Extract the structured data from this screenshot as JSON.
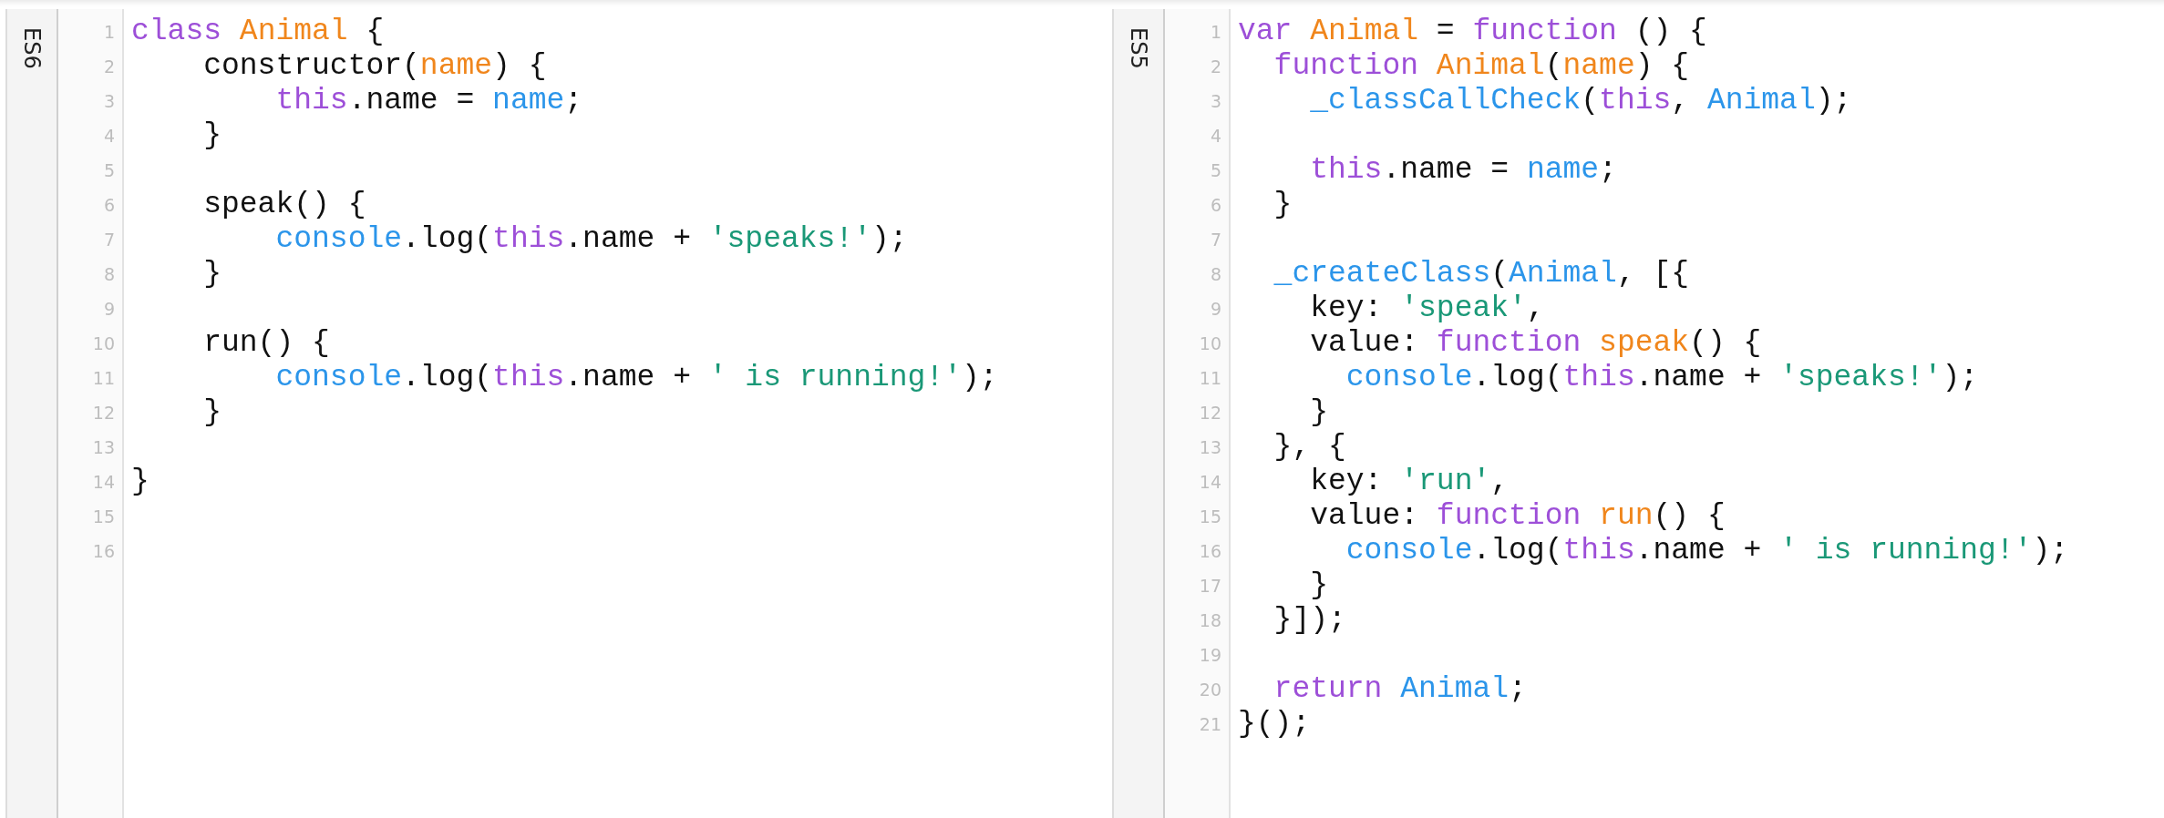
{
  "panels": [
    {
      "label": "ES6",
      "lines": [
        {
          "number": "1",
          "tokens": [
            {
              "kind": "keyword",
              "text": "class"
            },
            {
              "kind": "def",
              "text": " Animal"
            },
            {
              "kind": "plain",
              "text": " {"
            }
          ]
        },
        {
          "number": "2",
          "tokens": [
            {
              "kind": "plain",
              "text": "    constructor("
            },
            {
              "kind": "def",
              "text": "name"
            },
            {
              "kind": "plain",
              "text": ") {"
            }
          ]
        },
        {
          "number": "3",
          "tokens": [
            {
              "kind": "keyword",
              "text": "        this"
            },
            {
              "kind": "plain",
              "text": ".name = "
            },
            {
              "kind": "variable",
              "text": "name"
            },
            {
              "kind": "plain",
              "text": ";"
            }
          ]
        },
        {
          "number": "4",
          "tokens": [
            {
              "kind": "plain",
              "text": "    }"
            }
          ]
        },
        {
          "number": "5"
        },
        {
          "number": "6",
          "tokens": [
            {
              "kind": "plain",
              "text": "    speak() {"
            }
          ]
        },
        {
          "number": "7",
          "tokens": [
            {
              "kind": "variable",
              "text": "        console"
            },
            {
              "kind": "plain",
              "text": ".log("
            },
            {
              "kind": "keyword",
              "text": "this"
            },
            {
              "kind": "plain",
              "text": ".name + "
            },
            {
              "kind": "string",
              "text": "'speaks!'"
            },
            {
              "kind": "plain",
              "text": ");"
            }
          ]
        },
        {
          "number": "8",
          "tokens": [
            {
              "kind": "plain",
              "text": "    }"
            }
          ]
        },
        {
          "number": "9"
        },
        {
          "number": "10",
          "tokens": [
            {
              "kind": "plain",
              "text": "    run() {"
            }
          ]
        },
        {
          "number": "11",
          "tokens": [
            {
              "kind": "variable",
              "text": "        console"
            },
            {
              "kind": "plain",
              "text": ".log("
            },
            {
              "kind": "keyword",
              "text": "this"
            },
            {
              "kind": "plain",
              "text": ".name + "
            },
            {
              "kind": "string",
              "text": "' is running!'"
            },
            {
              "kind": "plain",
              "text": ");"
            }
          ]
        },
        {
          "number": "12",
          "tokens": [
            {
              "kind": "plain",
              "text": "    }"
            }
          ]
        },
        {
          "number": "13"
        },
        {
          "number": "14",
          "tokens": [
            {
              "kind": "plain",
              "text": "}"
            }
          ]
        },
        {
          "number": "15"
        },
        {
          "number": "16"
        }
      ]
    },
    {
      "label": "ES5",
      "lines": [
        {
          "number": "1",
          "tokens": [
            {
              "kind": "keyword",
              "text": "var"
            },
            {
              "kind": "def",
              "text": " Animal"
            },
            {
              "kind": "plain",
              "text": " = "
            },
            {
              "kind": "keyword",
              "text": "function"
            },
            {
              "kind": "plain",
              "text": " () {"
            }
          ]
        },
        {
          "number": "2",
          "tokens": [
            {
              "kind": "keyword",
              "text": "  function"
            },
            {
              "kind": "def",
              "text": " Animal"
            },
            {
              "kind": "plain",
              "text": "("
            },
            {
              "kind": "def",
              "text": "name"
            },
            {
              "kind": "plain",
              "text": ") {"
            }
          ]
        },
        {
          "number": "3",
          "tokens": [
            {
              "kind": "variable",
              "text": "    _classCallCheck"
            },
            {
              "kind": "plain",
              "text": "("
            },
            {
              "kind": "keyword",
              "text": "this"
            },
            {
              "kind": "plain",
              "text": ", "
            },
            {
              "kind": "variable",
              "text": "Animal"
            },
            {
              "kind": "plain",
              "text": ");"
            }
          ]
        },
        {
          "number": "4"
        },
        {
          "number": "5",
          "tokens": [
            {
              "kind": "keyword",
              "text": "    this"
            },
            {
              "kind": "plain",
              "text": ".name = "
            },
            {
              "kind": "variable",
              "text": "name"
            },
            {
              "kind": "plain",
              "text": ";"
            }
          ]
        },
        {
          "number": "6",
          "tokens": [
            {
              "kind": "plain",
              "text": "  }"
            }
          ]
        },
        {
          "number": "7"
        },
        {
          "number": "8",
          "tokens": [
            {
              "kind": "variable",
              "text": "  _createClass"
            },
            {
              "kind": "plain",
              "text": "("
            },
            {
              "kind": "variable",
              "text": "Animal"
            },
            {
              "kind": "plain",
              "text": ", [{"
            }
          ]
        },
        {
          "number": "9",
          "tokens": [
            {
              "kind": "plain",
              "text": "    key: "
            },
            {
              "kind": "string",
              "text": "'speak'"
            },
            {
              "kind": "plain",
              "text": ","
            }
          ]
        },
        {
          "number": "10",
          "tokens": [
            {
              "kind": "plain",
              "text": "    value: "
            },
            {
              "kind": "keyword",
              "text": "function"
            },
            {
              "kind": "def",
              "text": " speak"
            },
            {
              "kind": "plain",
              "text": "() {"
            }
          ]
        },
        {
          "number": "11",
          "tokens": [
            {
              "kind": "variable",
              "text": "      console"
            },
            {
              "kind": "plain",
              "text": ".log("
            },
            {
              "kind": "keyword",
              "text": "this"
            },
            {
              "kind": "plain",
              "text": ".name + "
            },
            {
              "kind": "string",
              "text": "'speaks!'"
            },
            {
              "kind": "plain",
              "text": ");"
            }
          ]
        },
        {
          "number": "12",
          "tokens": [
            {
              "kind": "plain",
              "text": "    }"
            }
          ]
        },
        {
          "number": "13",
          "tokens": [
            {
              "kind": "plain",
              "text": "  }, {"
            }
          ]
        },
        {
          "number": "14",
          "tokens": [
            {
              "kind": "plain",
              "text": "    key: "
            },
            {
              "kind": "string",
              "text": "'run'"
            },
            {
              "kind": "plain",
              "text": ","
            }
          ]
        },
        {
          "number": "15",
          "tokens": [
            {
              "kind": "plain",
              "text": "    value: "
            },
            {
              "kind": "keyword",
              "text": "function"
            },
            {
              "kind": "def",
              "text": " run"
            },
            {
              "kind": "plain",
              "text": "() {"
            }
          ]
        },
        {
          "number": "16",
          "tokens": [
            {
              "kind": "variable",
              "text": "      console"
            },
            {
              "kind": "plain",
              "text": ".log("
            },
            {
              "kind": "keyword",
              "text": "this"
            },
            {
              "kind": "plain",
              "text": ".name + "
            },
            {
              "kind": "string",
              "text": "' is running!'"
            },
            {
              "kind": "plain",
              "text": ");"
            }
          ]
        },
        {
          "number": "17",
          "tokens": [
            {
              "kind": "plain",
              "text": "    }"
            }
          ]
        },
        {
          "number": "18",
          "tokens": [
            {
              "kind": "plain",
              "text": "  }]);"
            }
          ]
        },
        {
          "number": "19"
        },
        {
          "number": "20",
          "tokens": [
            {
              "kind": "keyword",
              "text": "  return"
            },
            {
              "kind": "variable",
              "text": " Animal"
            },
            {
              "kind": "plain",
              "text": ";"
            }
          ]
        },
        {
          "number": "21",
          "tokens": [
            {
              "kind": "plain",
              "text": "}();"
            }
          ]
        }
      ]
    }
  ]
}
